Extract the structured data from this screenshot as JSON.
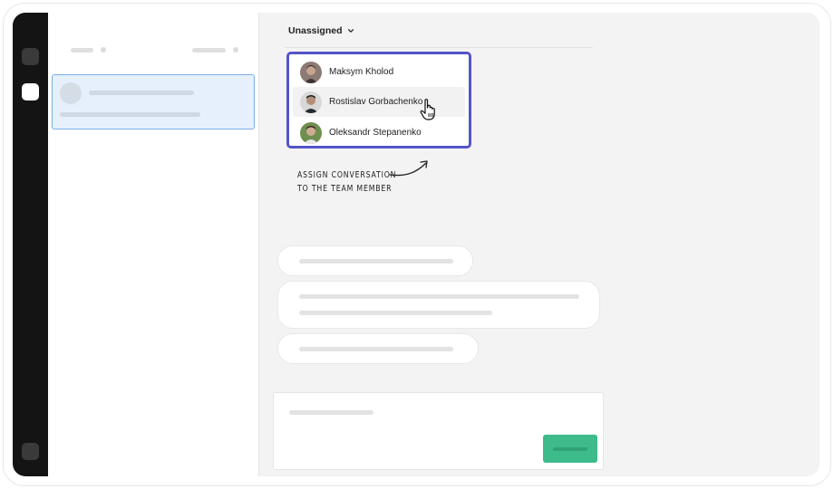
{
  "assign": {
    "label": "Unassigned",
    "chevron_icon": "chevron-down-icon"
  },
  "team_members": [
    {
      "name": "Maksym Kholod",
      "avatar_color": "#6b5a55",
      "hovered": false
    },
    {
      "name": "Rostislav Gorbachenko",
      "avatar_color": "#2f2f33",
      "hovered": true
    },
    {
      "name": "Oleksandr Stepanenko",
      "avatar_color": "#4d6a3c",
      "hovered": false
    }
  ],
  "annotation": {
    "line1": "Assign conversation",
    "line2": "to the team member"
  },
  "colors": {
    "rail": "#141414",
    "dropdown_border": "#5554c9",
    "selected_conversation": "#e5f0fc",
    "send_button": "#3dbb8a"
  },
  "icons": {
    "pointer": "hand-pointer-icon",
    "annotation_arrow": "curved-arrow-icon"
  }
}
